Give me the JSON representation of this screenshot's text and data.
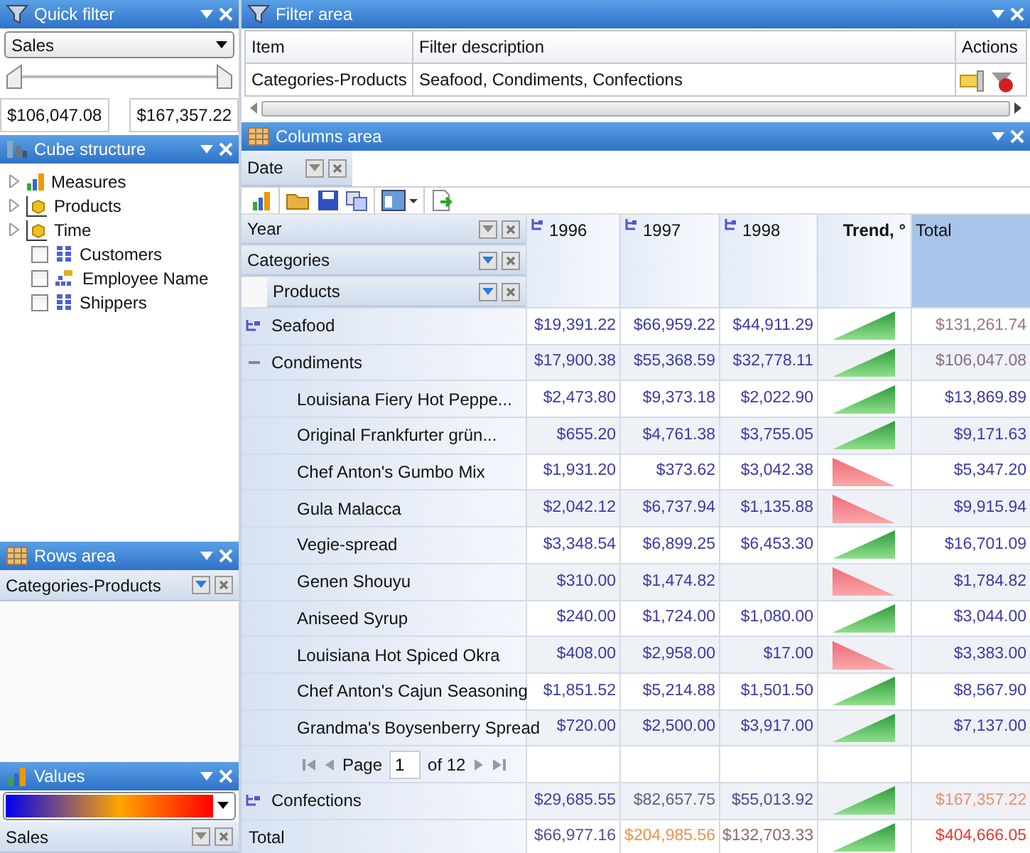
{
  "quick_filter": {
    "title": "Quick filter",
    "measure": "Sales",
    "thumbs": [
      {
        "level": 0
      },
      {
        "level": 1
      }
    ],
    "min": "$106,047.08",
    "max": "$167,357.22"
  },
  "cube_structure": {
    "title": "Cube structure",
    "items": [
      {
        "kind": "measures",
        "label": "Measures",
        "expanded": false
      },
      {
        "kind": "dimension",
        "label": "Products",
        "expanded": false
      },
      {
        "kind": "dimension",
        "label": "Time",
        "expanded": false
      },
      {
        "kind": "attribute",
        "label": "Customers",
        "checked": false
      },
      {
        "kind": "hierarchy",
        "label": "Employee Name",
        "checked": false
      },
      {
        "kind": "attribute",
        "label": "Shippers",
        "checked": false
      }
    ]
  },
  "rows_area": {
    "title": "Rows area",
    "fields": [
      {
        "label": "Categories-Products",
        "filtered": true
      }
    ]
  },
  "values": {
    "title": "Values",
    "fields": [
      {
        "label": "Sales",
        "filtered": false
      }
    ]
  },
  "filter_area": {
    "title": "Filter area",
    "columns": [
      "Item",
      "Filter description",
      "Actions"
    ],
    "rows": [
      {
        "item": "Categories-Products",
        "description": "Seafood, Condiments, Confections"
      }
    ]
  },
  "columns_area": {
    "title": "Columns area",
    "fields": [
      {
        "label": "Date",
        "filtered": false
      }
    ]
  },
  "pivot": {
    "row_fields": [
      {
        "label": "Year",
        "filtered": false
      },
      {
        "label": "Categories",
        "filtered": true
      },
      {
        "label": "Products",
        "filtered": true
      }
    ],
    "columns": [
      {
        "kind": "year",
        "label": "1996"
      },
      {
        "kind": "year",
        "label": "1997"
      },
      {
        "kind": "year",
        "label": "1998"
      },
      {
        "kind": "trend",
        "label": "Trend, °"
      },
      {
        "kind": "total",
        "label": "Total"
      }
    ],
    "rows": [
      {
        "kind": "group",
        "label": "Seafood",
        "expanded": false,
        "rising": true,
        "cells": {
          "y1996": {
            "text": "$19,391.22",
            "color": "#3a3aa8"
          },
          "y1997": {
            "text": "$66,959.22",
            "color": "#3a3aa8"
          },
          "y1998": {
            "text": "$44,911.29",
            "color": "#3a3aa8"
          },
          "total": {
            "text": "$131,261.74",
            "color": "#a07878"
          }
        }
      },
      {
        "kind": "group",
        "label": "Condiments",
        "expanded": true,
        "rising": true,
        "cells": {
          "y1996": {
            "text": "$17,900.38",
            "color": "#3a3aa8"
          },
          "y1997": {
            "text": "$55,368.59",
            "color": "#3a3aa8"
          },
          "y1998": {
            "text": "$32,778.11",
            "color": "#3a3aa8"
          },
          "total": {
            "text": "$106,047.08",
            "color": "#8c6c84"
          }
        }
      },
      {
        "kind": "item",
        "label": "Louisiana Fiery Hot Peppe...",
        "rising": true,
        "cells": {
          "y1996": {
            "text": "$2,473.80",
            "color": "#3a3aa8"
          },
          "y1997": {
            "text": "$9,373.18",
            "color": "#3a3aa8"
          },
          "y1998": {
            "text": "$2,022.90",
            "color": "#3a3aa8"
          },
          "total": {
            "text": "$13,869.89",
            "color": "#3a3aa8"
          }
        }
      },
      {
        "kind": "item",
        "label": "Original Frankfurter grün...",
        "rising": true,
        "cells": {
          "y1996": {
            "text": "$655.20",
            "color": "#3a3aa8"
          },
          "y1997": {
            "text": "$4,761.38",
            "color": "#3a3aa8"
          },
          "y1998": {
            "text": "$3,755.05",
            "color": "#3a3aa8"
          },
          "total": {
            "text": "$9,171.63",
            "color": "#3a3aa8"
          }
        }
      },
      {
        "kind": "item",
        "label": "Chef Anton's Gumbo Mix",
        "rising": false,
        "cells": {
          "y1996": {
            "text": "$1,931.20",
            "color": "#3a3aa8"
          },
          "y1997": {
            "text": "$373.62",
            "color": "#3a3aa8"
          },
          "y1998": {
            "text": "$3,042.38",
            "color": "#3a3aa8"
          },
          "total": {
            "text": "$5,347.20",
            "color": "#3a3aa8"
          }
        }
      },
      {
        "kind": "item",
        "label": "Gula Malacca",
        "rising": false,
        "cells": {
          "y1996": {
            "text": "$2,042.12",
            "color": "#3a3aa8"
          },
          "y1997": {
            "text": "$6,737.94",
            "color": "#3a3aa8"
          },
          "y1998": {
            "text": "$1,135.88",
            "color": "#3a3aa8"
          },
          "total": {
            "text": "$9,915.94",
            "color": "#3a3aa8"
          }
        }
      },
      {
        "kind": "item",
        "label": "Vegie-spread",
        "rising": true,
        "cells": {
          "y1996": {
            "text": "$3,348.54",
            "color": "#3a3aa8"
          },
          "y1997": {
            "text": "$6,899.25",
            "color": "#3a3aa8"
          },
          "y1998": {
            "text": "$6,453.30",
            "color": "#3a3aa8"
          },
          "total": {
            "text": "$16,701.09",
            "color": "#3a3aa8"
          }
        }
      },
      {
        "kind": "item",
        "label": "Genen Shouyu",
        "rising": false,
        "cells": {
          "y1996": {
            "text": "$310.00",
            "color": "#3a3aa8"
          },
          "y1997": {
            "text": "$1,474.82",
            "color": "#3a3aa8"
          },
          "total": {
            "text": "$1,784.82",
            "color": "#3a3aa8"
          }
        }
      },
      {
        "kind": "item",
        "label": "Aniseed Syrup",
        "rising": true,
        "cells": {
          "y1996": {
            "text": "$240.00",
            "color": "#3a3aa8"
          },
          "y1997": {
            "text": "$1,724.00",
            "color": "#3a3aa8"
          },
          "y1998": {
            "text": "$1,080.00",
            "color": "#3a3aa8"
          },
          "total": {
            "text": "$3,044.00",
            "color": "#3a3aa8"
          }
        }
      },
      {
        "kind": "item",
        "label": "Louisiana Hot Spiced Okra",
        "rising": false,
        "cells": {
          "y1996": {
            "text": "$408.00",
            "color": "#3a3aa8"
          },
          "y1997": {
            "text": "$2,958.00",
            "color": "#3a3aa8"
          },
          "y1998": {
            "text": "$17.00",
            "color": "#3a3aa8"
          },
          "total": {
            "text": "$3,383.00",
            "color": "#3a3aa8"
          }
        }
      },
      {
        "kind": "item",
        "label": "Chef Anton's Cajun Seasoning",
        "rising": true,
        "cells": {
          "y1996": {
            "text": "$1,851.52",
            "color": "#3a3aa8"
          },
          "y1997": {
            "text": "$5,214.88",
            "color": "#3a3aa8"
          },
          "y1998": {
            "text": "$1,501.50",
            "color": "#3a3aa8"
          },
          "total": {
            "text": "$8,567.90",
            "color": "#3a3aa8"
          }
        }
      },
      {
        "kind": "item",
        "label": "Grandma's Boysenberry Spread",
        "rising": true,
        "cells": {
          "y1996": {
            "text": "$720.00",
            "color": "#3a3aa8"
          },
          "y1997": {
            "text": "$2,500.00",
            "color": "#3a3aa8"
          },
          "y1998": {
            "text": "$3,917.00",
            "color": "#3a3aa8"
          },
          "total": {
            "text": "$7,137.00",
            "color": "#3a3aa8"
          }
        }
      },
      {
        "kind": "pager",
        "label": "Page",
        "page": "1",
        "of": "of 12"
      },
      {
        "kind": "group",
        "label": "Confections",
        "expanded": false,
        "rising": true,
        "cells": {
          "y1996": {
            "text": "$29,685.55",
            "color": "#4a3aa0"
          },
          "y1997": {
            "text": "$82,657.75",
            "color": "#5e5e7a"
          },
          "y1998": {
            "text": "$55,013.92",
            "color": "#4a4a98"
          },
          "total": {
            "text": "$167,357.22",
            "color": "#e8926a"
          }
        }
      },
      {
        "kind": "total",
        "label": "Total",
        "rising": true,
        "cells": {
          "y1996": {
            "text": "$66,977.16",
            "color": "#5a4a98"
          },
          "y1997": {
            "text": "$204,985.56",
            "color": "#f0904a"
          },
          "y1998": {
            "text": "$132,703.33",
            "color": "#8a6a6a"
          },
          "total": {
            "text": "$404,666.05",
            "color": "#e83a2a"
          }
        }
      }
    ]
  }
}
